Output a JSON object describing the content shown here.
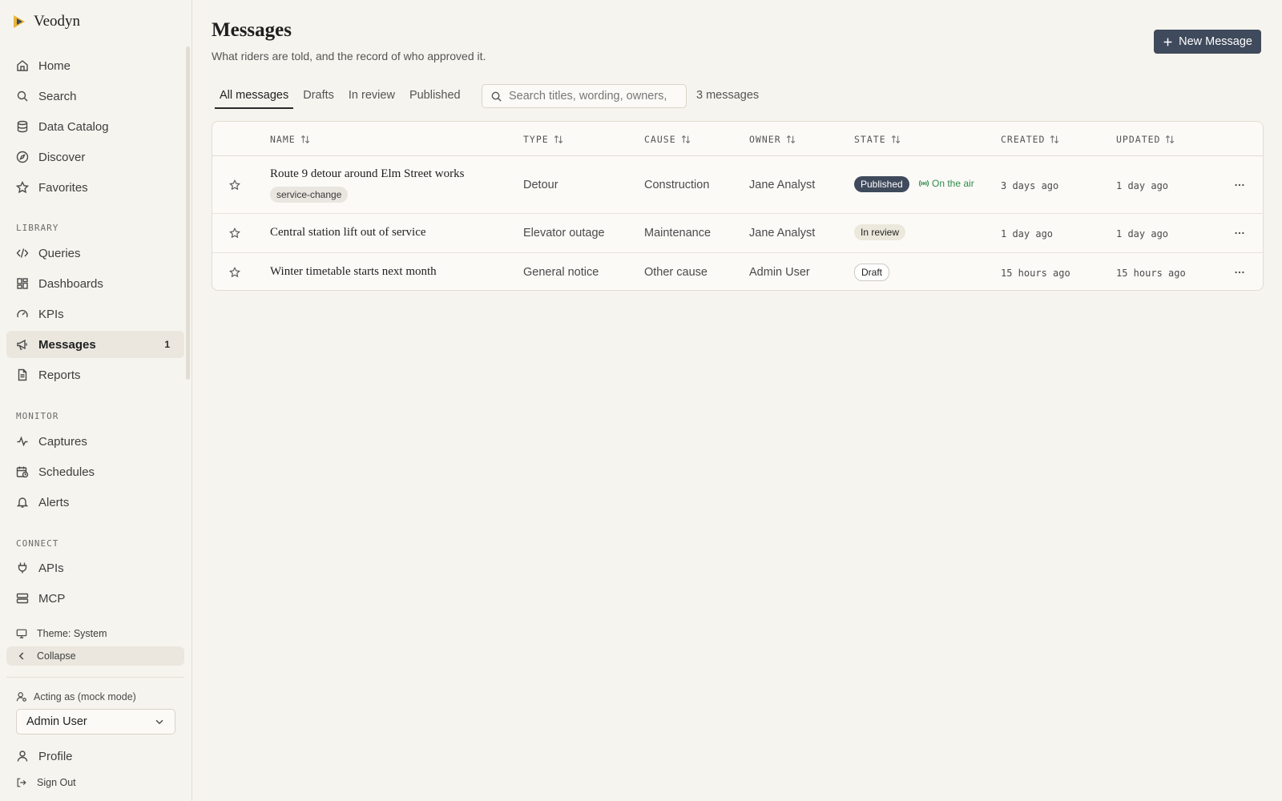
{
  "app": {
    "name": "Veodyn",
    "brand_color": "#e9b53a"
  },
  "sidebar": {
    "items": [
      {
        "label": "Home",
        "icon": "home-icon"
      },
      {
        "label": "Search",
        "icon": "search-icon"
      },
      {
        "label": "Data Catalog",
        "icon": "database-icon"
      },
      {
        "label": "Discover",
        "icon": "compass-icon"
      },
      {
        "label": "Favorites",
        "icon": "star-icon"
      }
    ],
    "library_label": "LIBRARY",
    "library": [
      {
        "label": "Queries",
        "icon": "code-icon"
      },
      {
        "label": "Dashboards",
        "icon": "dashboard-icon"
      },
      {
        "label": "KPIs",
        "icon": "gauge-icon"
      },
      {
        "label": "Messages",
        "icon": "megaphone-icon",
        "count": "1",
        "active": true
      },
      {
        "label": "Reports",
        "icon": "document-icon"
      }
    ],
    "monitor_label": "MONITOR",
    "monitor": [
      {
        "label": "Captures",
        "icon": "activity-icon"
      },
      {
        "label": "Schedules",
        "icon": "calendar-clock-icon"
      },
      {
        "label": "Alerts",
        "icon": "bell-icon"
      }
    ],
    "connect_label": "CONNECT",
    "connect": [
      {
        "label": "APIs",
        "icon": "plug-icon"
      },
      {
        "label": "MCP",
        "icon": "server-icon"
      }
    ],
    "theme_label": "Theme: System",
    "collapse_label": "Collapse",
    "acting_label": "Acting as (mock mode)",
    "acting_user": "Admin User",
    "profile_label": "Profile",
    "signout_label": "Sign Out"
  },
  "page": {
    "title": "Messages",
    "subtitle": "What riders are told, and the record of who approved it.",
    "new_button": "New Message",
    "tabs": [
      "All messages",
      "Drafts",
      "In review",
      "Published"
    ],
    "active_tab": "All messages",
    "search_placeholder": "Search titles, wording, owners, tags",
    "count_text": "3 messages"
  },
  "table": {
    "columns": [
      "NAME",
      "TYPE",
      "CAUSE",
      "OWNER",
      "STATE",
      "CREATED",
      "UPDATED"
    ],
    "rows": [
      {
        "name": "Route 9 detour around Elm Street works",
        "tag": "service-change",
        "type": "Detour",
        "cause": "Construction",
        "owner": "Jane Analyst",
        "state": "Published",
        "extra": "On the air",
        "created": "3 days ago",
        "updated": "1 day ago"
      },
      {
        "name": "Central station lift out of service",
        "type": "Elevator outage",
        "cause": "Maintenance",
        "owner": "Jane Analyst",
        "state": "In review",
        "created": "1 day ago",
        "updated": "1 day ago"
      },
      {
        "name": "Winter timetable starts next month",
        "type": "General notice",
        "cause": "Other cause",
        "owner": "Admin User",
        "state": "Draft",
        "created": "15 hours ago",
        "updated": "15 hours ago"
      }
    ]
  }
}
